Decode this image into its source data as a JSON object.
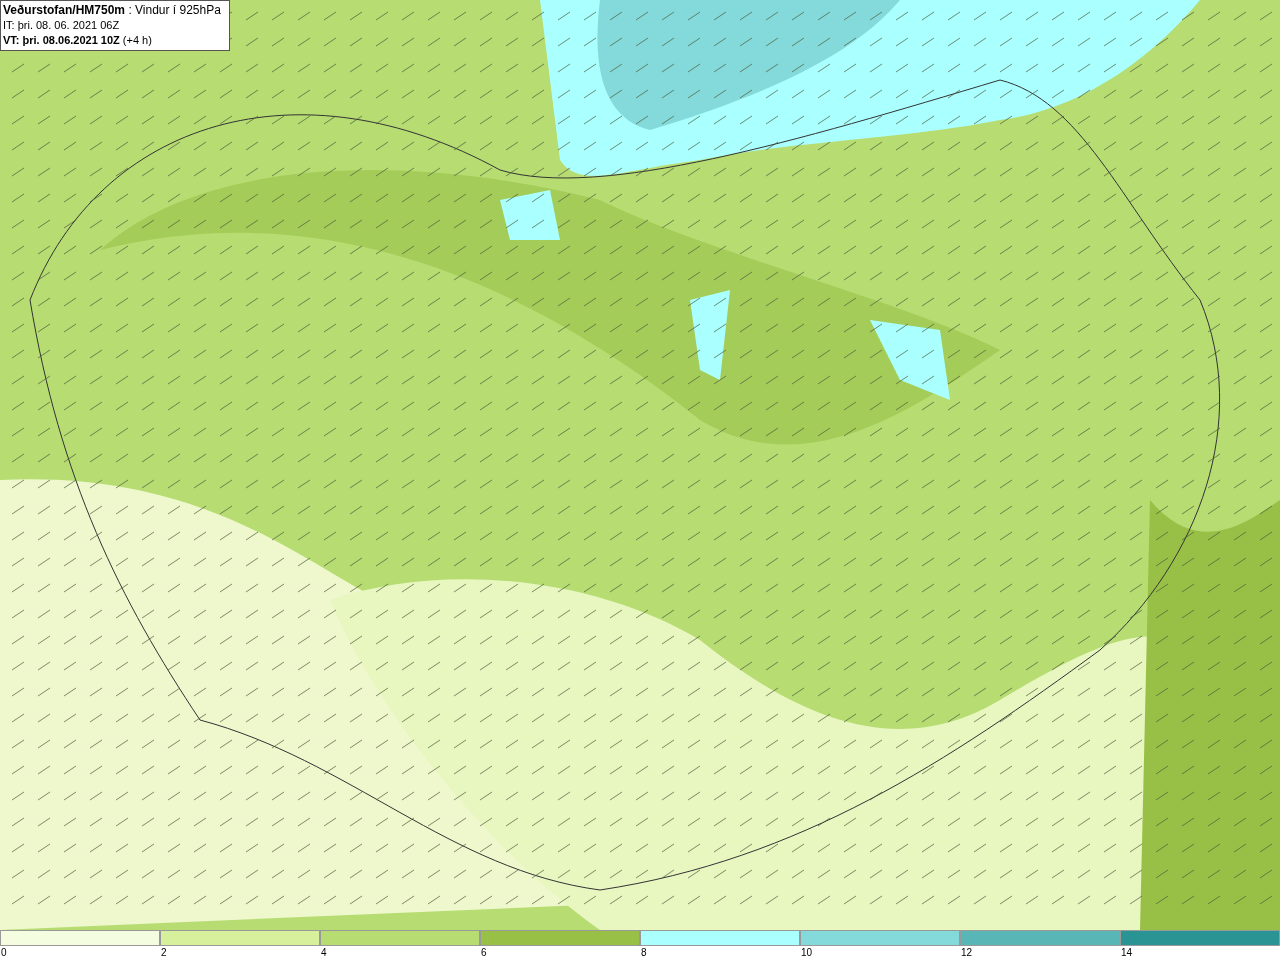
{
  "header": {
    "lines": [
      "**Veðurstofan/HM750m** : Vindur í 925hPa",
      "IT: þri. 08. 06. 2021 06Z",
      "**VT: þri. 08.06.2021 10Z** (+4 h)"
    ]
  },
  "legend": [
    {
      "color": "#f5fde0",
      "label": "0"
    },
    {
      "color": "#d6f09c",
      "label": "2"
    },
    {
      "color": "#b6dc72",
      "label": "4"
    },
    {
      "color": "#98c046",
      "label": "6"
    },
    {
      "color": "#aaffff",
      "label": "8"
    },
    {
      "color": "#84dada",
      "label": "10"
    },
    {
      "color": "#58b6b6",
      "label": "12"
    },
    {
      "color": "#2a9494",
      "label": "14"
    }
  ]
}
